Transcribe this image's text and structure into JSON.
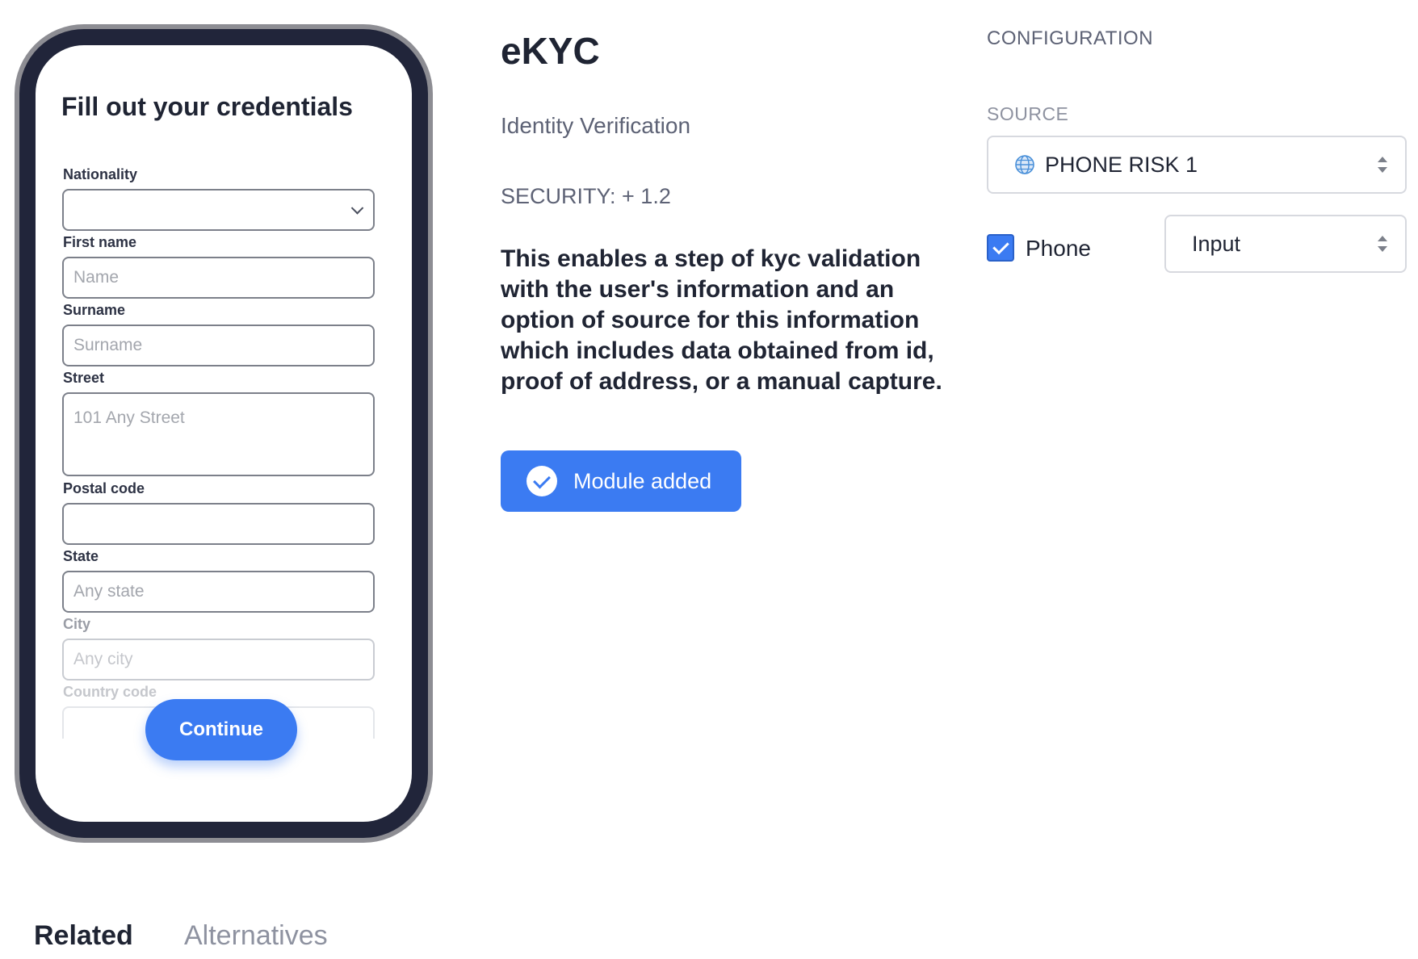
{
  "form": {
    "title": "Fill out your credentials",
    "fields": [
      {
        "label": "Nationality",
        "value": "",
        "placeholder": ""
      },
      {
        "label": "First name",
        "placeholder": "Name"
      },
      {
        "label": "Surname",
        "placeholder": "Surname"
      },
      {
        "label": "Street",
        "placeholder": "101 Any Street"
      },
      {
        "label": "Postal code",
        "placeholder": ""
      },
      {
        "label": "State",
        "placeholder": "Any state"
      },
      {
        "label": "City",
        "placeholder": "Any city"
      },
      {
        "label": "Country code",
        "placeholder": ""
      }
    ],
    "continue_label": "Continue"
  },
  "module": {
    "title": "eKYC",
    "subtitle": "Identity Verification",
    "security": "SECURITY: + 1.2",
    "description": "This enables a step of kyc validation with the user's information and an option of source for this information which includes data obtained from id, proof of address, or a manual capture.",
    "added_label": "Module added"
  },
  "config": {
    "heading": "CONFIGURATION",
    "source_heading": "SOURCE",
    "source_value": "PHONE RISK 1",
    "phone_checkbox_label": "Phone",
    "phone_checked": true,
    "phone_mode": "Input"
  },
  "tabs": [
    "Related",
    "Alternatives"
  ],
  "colors": {
    "accent": "#3b7bf2",
    "text_dark": "#1f2433",
    "text_muted": "#5d6275"
  }
}
